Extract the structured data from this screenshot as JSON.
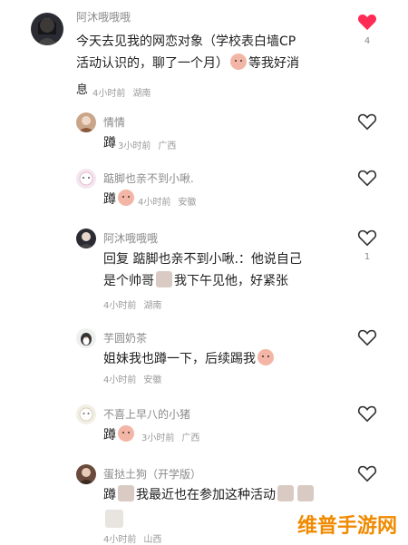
{
  "comments": [
    {
      "name": "阿沐哦哦哦",
      "text_line1": "今天去见我的网恋对象（学校表白墙CP",
      "text_line2": "活动认识的，聊了一个月）",
      "text_line2_tail": "等我好消",
      "text_line3": "息",
      "time": "4小时前",
      "location": "湖南",
      "liked": true,
      "likes": "4"
    },
    {
      "name": "情情",
      "text": "蹲",
      "time": "3小时前",
      "location": "广西",
      "liked": false
    },
    {
      "name": "踮脚也亲不到小啾.",
      "text": "蹲",
      "time": "4小时前",
      "location": "安徽",
      "liked": false
    },
    {
      "name": "阿沐哦哦哦",
      "text_line1": "回复 踮脚也亲不到小啾.：他说自己",
      "text_line2": "是个帅哥",
      "text_line2_tail": "我下午见他，好紧张",
      "time": "4小时前",
      "location": "湖南",
      "liked": false,
      "likes": "1"
    },
    {
      "name": "芋圆奶茶",
      "text": "姐妹我也蹲一下，后续踢我",
      "time": "4小时前",
      "location": "安徽",
      "liked": false
    },
    {
      "name": "不喜上早八的小猪",
      "text": "蹲",
      "time": "3小时前",
      "location": "广西",
      "liked": false
    },
    {
      "name": "蛋挞土狗（开学版）",
      "text": "蹲",
      "text_tail": "我最近也在参加这种活动",
      "time": "4小时前",
      "location": "山西",
      "liked": false
    }
  ],
  "watermark": "维普手游网",
  "colors": {
    "heart_active": "#fe2c55",
    "heart_outline": "#333333"
  }
}
